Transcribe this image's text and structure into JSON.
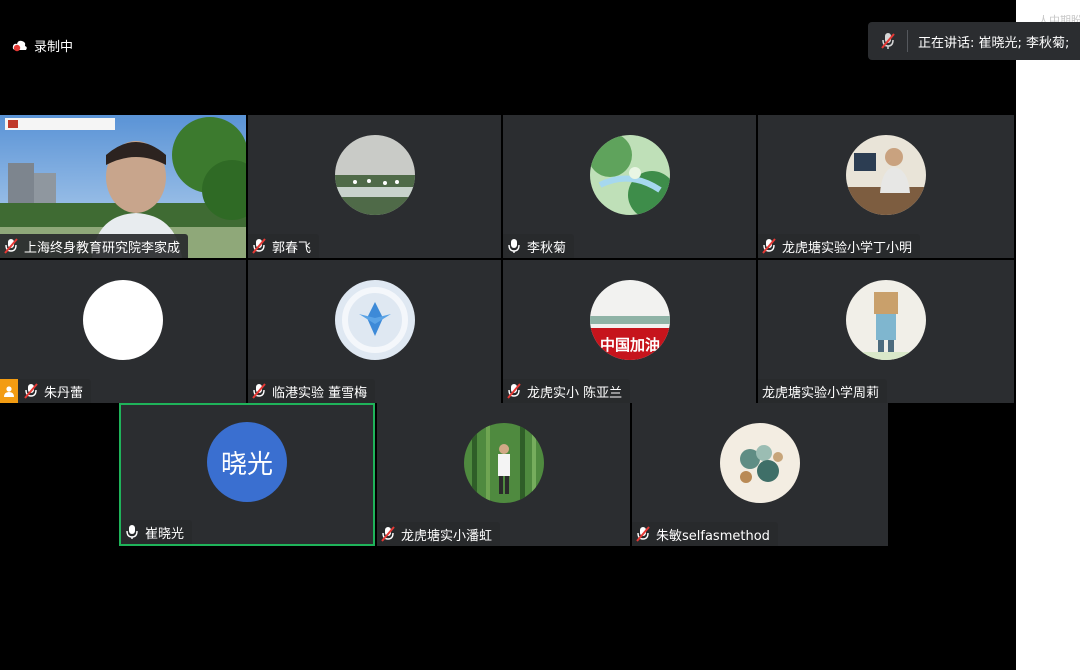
{
  "recording": {
    "label": "录制中"
  },
  "speaking": {
    "text": "正在讲话:  崔晓光; 李秋菊;"
  },
  "side_panel": {
    "peek_text": "人中期盼"
  },
  "participants": [
    {
      "name": "上海终身教育研究院李家成"
    },
    {
      "name": "郭春飞"
    },
    {
      "name": "李秋菊"
    },
    {
      "name": "龙虎塘实验小学丁小明"
    },
    {
      "name": "朱丹蕾"
    },
    {
      "name": "临港实验   董雪梅"
    },
    {
      "name": "龙虎实小   陈亚兰",
      "avatar_text": "中国加油"
    },
    {
      "name": "龙虎塘实验小学周莉"
    },
    {
      "name": "崔晓光",
      "avatar_text": "晓光"
    },
    {
      "name": "龙虎塘实小潘虹"
    },
    {
      "name": "朱敏selfasmethod"
    }
  ],
  "colors": {
    "tile_bg": "#2b2d30",
    "active_border": "#1fb35a",
    "avatar_blue": "#3a6fd0",
    "recording_red": "#e53935"
  }
}
